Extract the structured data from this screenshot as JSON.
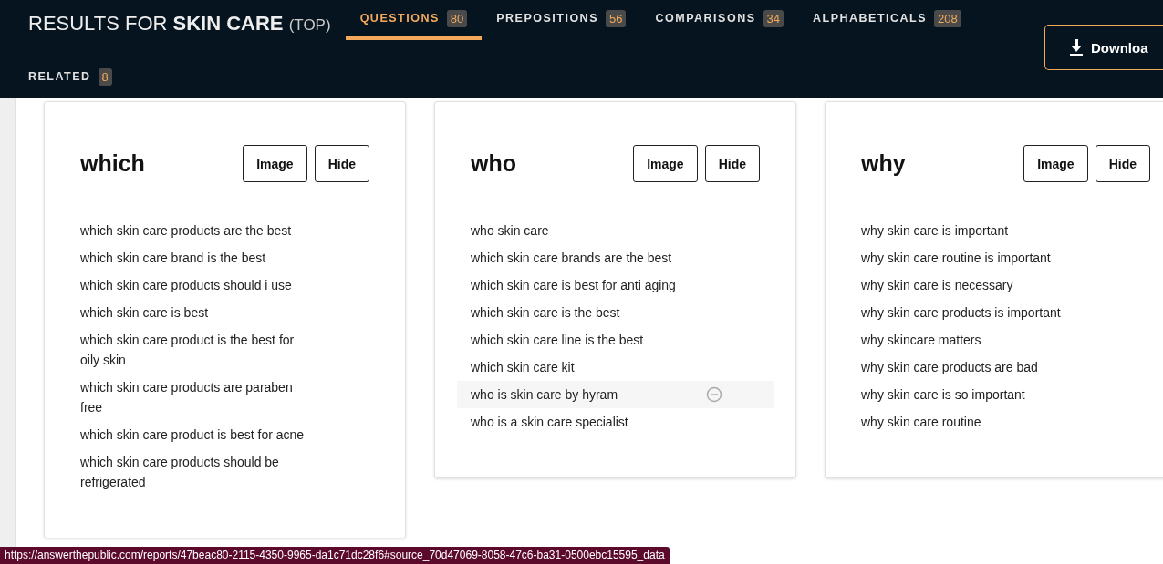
{
  "header": {
    "title_prefix": "RESULTS FOR",
    "keyword": "SKIN CARE",
    "scope": "(TOP)"
  },
  "tabs": [
    {
      "label": "QUESTIONS",
      "count": "80",
      "selected": true
    },
    {
      "label": "PREPOSITIONS",
      "count": "56",
      "selected": false
    },
    {
      "label": "COMPARISONS",
      "count": "34",
      "selected": false
    },
    {
      "label": "ALPHABETICALS",
      "count": "208",
      "selected": false
    },
    {
      "label": "RELATED",
      "count": "8",
      "selected": false
    }
  ],
  "download_button": "Downloa",
  "cards": [
    {
      "title": "which",
      "image_button": "Image",
      "hide_button": "Hide",
      "items": [
        {
          "text": "which skin care products are the best",
          "highlighted": false
        },
        {
          "text": "which skin care brand is the best",
          "highlighted": false
        },
        {
          "text": "which skin care products should i use",
          "highlighted": false
        },
        {
          "text": "which skin care is best",
          "highlighted": false
        },
        {
          "text": "which skin care product is the best for oily skin",
          "highlighted": false
        },
        {
          "text": "which skin care products are paraben free",
          "highlighted": false
        },
        {
          "text": "which skin care product is best for acne",
          "highlighted": false
        },
        {
          "text": "which skin care products should be refrigerated",
          "highlighted": false
        }
      ]
    },
    {
      "title": "who",
      "image_button": "Image",
      "hide_button": "Hide",
      "items": [
        {
          "text": "who skin care",
          "highlighted": false
        },
        {
          "text": "which skin care brands are the best",
          "highlighted": false
        },
        {
          "text": "which skin care is best for anti aging",
          "highlighted": false
        },
        {
          "text": "which skin care is the best",
          "highlighted": false
        },
        {
          "text": "which skin care line is the best",
          "highlighted": false
        },
        {
          "text": "which skin care kit",
          "highlighted": false
        },
        {
          "text": "who is skin care by hyram",
          "highlighted": true
        },
        {
          "text": "who is a skin care specialist",
          "highlighted": false
        }
      ]
    },
    {
      "title": "why",
      "image_button": "Image",
      "hide_button": "Hide",
      "items": [
        {
          "text": "why skin care is important",
          "highlighted": false
        },
        {
          "text": "why skin care routine is important",
          "highlighted": false
        },
        {
          "text": "why skin care is necessary",
          "highlighted": false
        },
        {
          "text": "why skin care products is important",
          "highlighted": false
        },
        {
          "text": "why skincare matters",
          "highlighted": false
        },
        {
          "text": "why skin care products are bad",
          "highlighted": false
        },
        {
          "text": "why skin care is so important",
          "highlighted": false
        },
        {
          "text": "why skin care routine",
          "highlighted": false
        }
      ]
    }
  ],
  "status_url": "https://answerthepublic.com/reports/47beac80-2115-4350-9965-da1c71dc28f6#source_70d47069-8058-47c6-ba31-0500ebc15595_data"
}
